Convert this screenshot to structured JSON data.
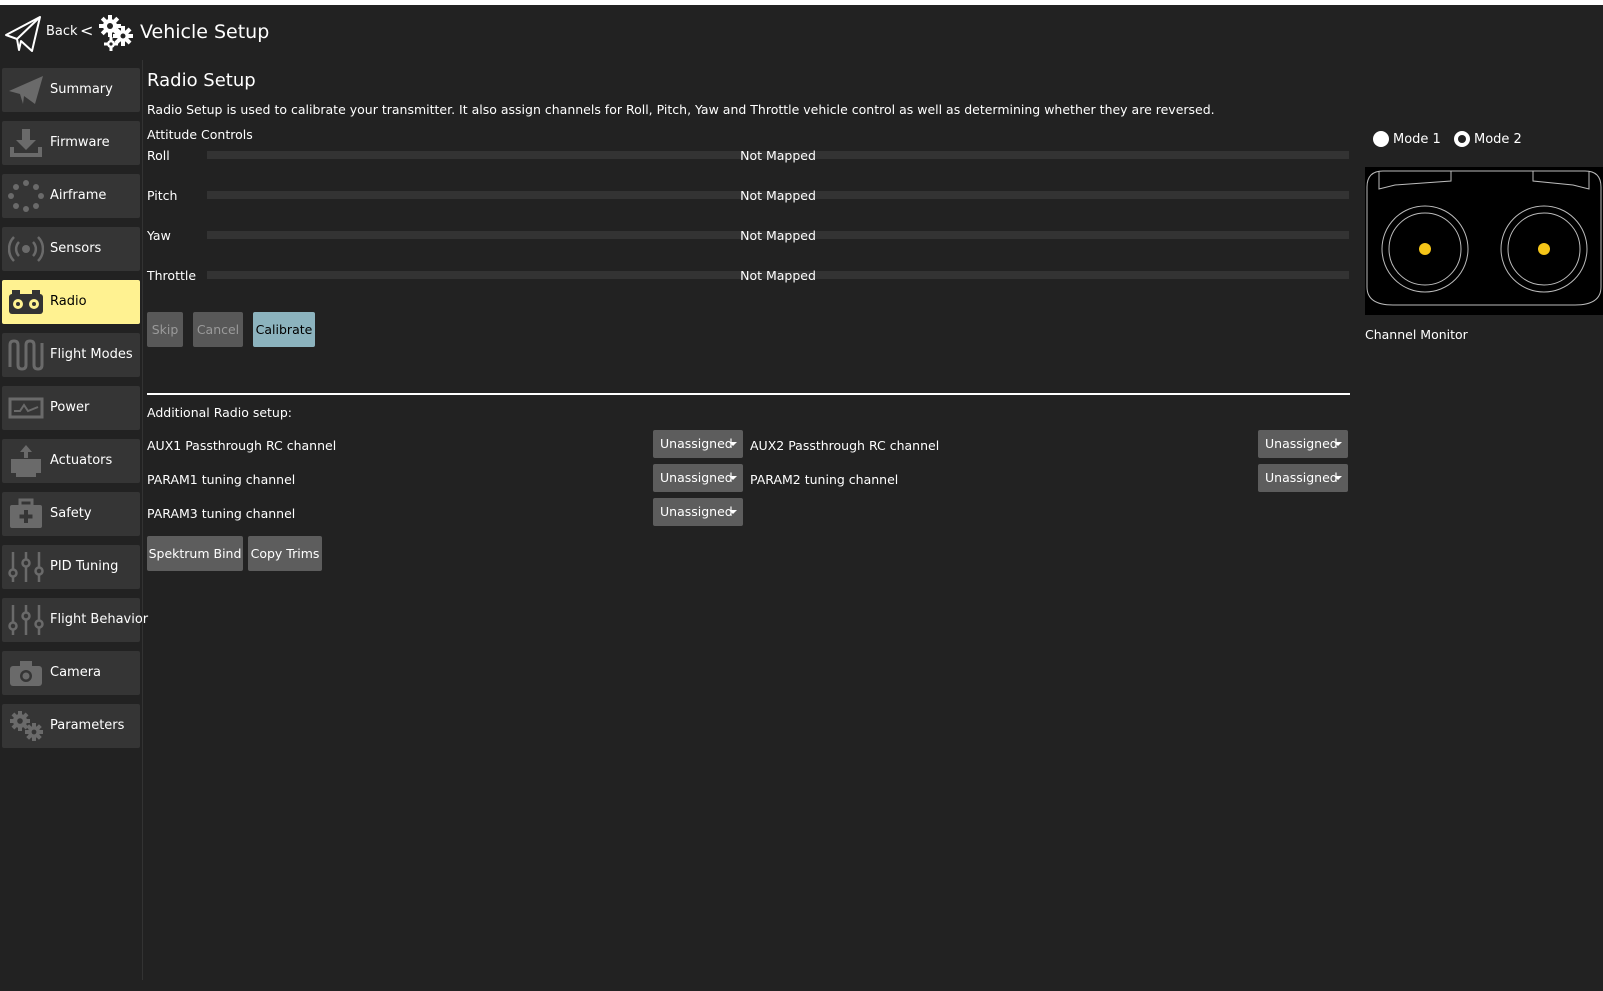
{
  "header": {
    "back_label": "Back",
    "separator": "<",
    "title": "Vehicle Setup"
  },
  "sidebar": {
    "items": [
      {
        "label": "Summary",
        "icon": "paper-plane-icon"
      },
      {
        "label": "Firmware",
        "icon": "download-icon"
      },
      {
        "label": "Airframe",
        "icon": "airframe-dots-icon"
      },
      {
        "label": "Sensors",
        "icon": "sensors-icon"
      },
      {
        "label": "Radio",
        "icon": "radio-transmitter-icon",
        "active": true
      },
      {
        "label": "Flight Modes",
        "icon": "flight-modes-wave-icon"
      },
      {
        "label": "Power",
        "icon": "power-icon"
      },
      {
        "label": "Actuators",
        "icon": "actuators-icon"
      },
      {
        "label": "Safety",
        "icon": "first-aid-kit-icon"
      },
      {
        "label": "PID Tuning",
        "icon": "sliders-icon"
      },
      {
        "label": "Flight Behavior",
        "icon": "sliders-icon"
      },
      {
        "label": "Camera",
        "icon": "camera-icon"
      },
      {
        "label": "Parameters",
        "icon": "gears-icon"
      }
    ],
    "active_color": "#fff291"
  },
  "main": {
    "title": "Radio Setup",
    "description": "Radio Setup is used to calibrate your transmitter. It also assign channels for Roll, Pitch, Yaw and Throttle vehicle control as well as determining whether they are reversed.",
    "attitude_title": "Attitude Controls",
    "controls": [
      {
        "label": "Roll",
        "value": "Not Mapped"
      },
      {
        "label": "Pitch",
        "value": "Not Mapped"
      },
      {
        "label": "Yaw",
        "value": "Not Mapped"
      },
      {
        "label": "Throttle",
        "value": "Not Mapped"
      }
    ],
    "buttons": {
      "skip": "Skip",
      "cancel": "Cancel",
      "calibrate": "Calibrate"
    },
    "additional_title": "Additional Radio setup:",
    "rows": {
      "aux1": {
        "label": "AUX1 Passthrough RC channel",
        "value": "Unassigned"
      },
      "aux2": {
        "label": "AUX2 Passthrough RC channel",
        "value": "Unassigned"
      },
      "param1": {
        "label": "PARAM1 tuning channel",
        "value": "Unassigned"
      },
      "param2": {
        "label": "PARAM2 tuning channel",
        "value": "Unassigned"
      },
      "param3": {
        "label": "PARAM3 tuning channel",
        "value": "Unassigned"
      }
    },
    "spektrum_bind": "Spektrum Bind",
    "copy_trims": "Copy Trims"
  },
  "right": {
    "mode1": "Mode 1",
    "mode2": "Mode 2",
    "selected_mode": "Mode 2",
    "channel_monitor": "Channel Monitor",
    "stick_color": "#f5c518"
  }
}
